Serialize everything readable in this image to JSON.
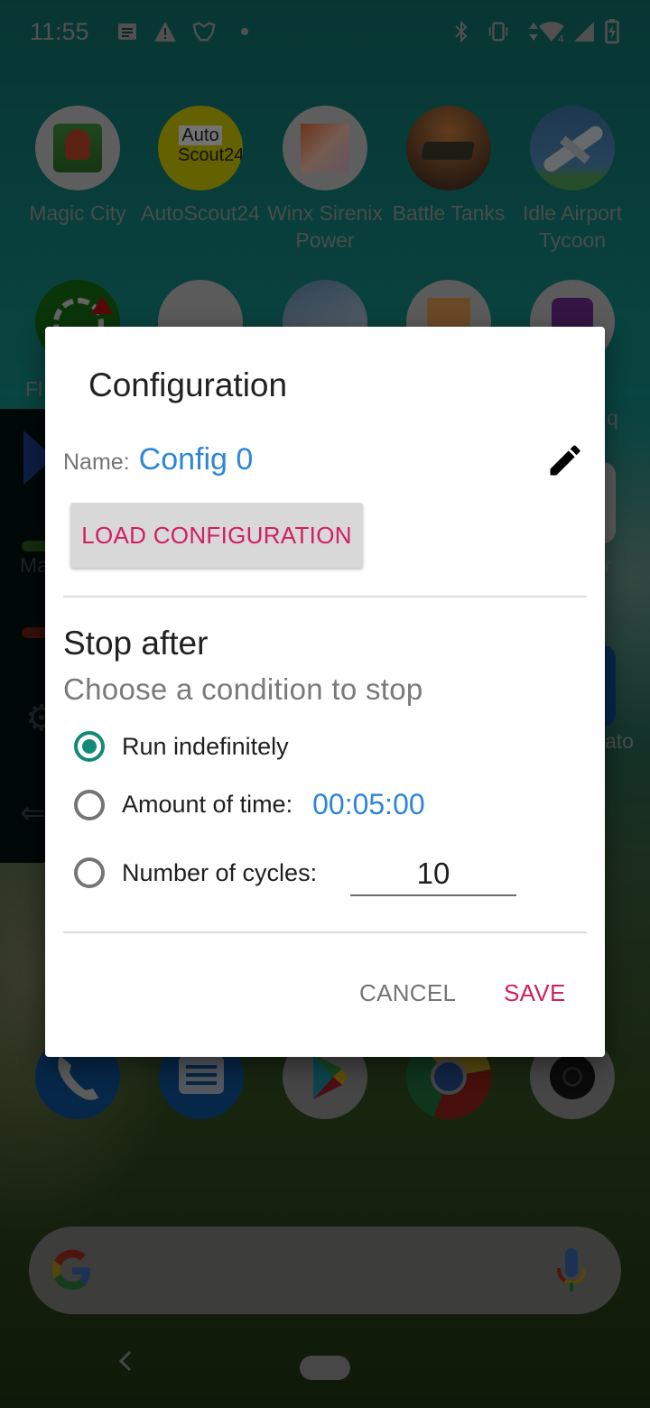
{
  "status_bar": {
    "time": "11:55",
    "left_icons": [
      "notes-icon",
      "warning-icon",
      "game-crest-icon",
      "dot-icon"
    ],
    "right_icons": [
      "bluetooth-icon",
      "vibrate-icon",
      "data-arrows-icon",
      "wifi-icon",
      "signal-icon",
      "battery-charging-icon"
    ],
    "wifi_badge": "4"
  },
  "home": {
    "apps_row1": [
      {
        "label": "Magic City",
        "icon": "magic-city-icon"
      },
      {
        "label": "AutoScout24",
        "icon": "autoscout24-icon",
        "logo_top": "Auto",
        "logo_bottom": "Scout24"
      },
      {
        "label": "Winx Sirenix Power",
        "icon": "winx-icon"
      },
      {
        "label": "Battle Tanks",
        "icon": "battle-tanks-icon"
      },
      {
        "label": "Idle Airport Tycoon",
        "icon": "idle-airport-icon"
      }
    ],
    "apps_row2_partial_labels": {
      "left": "Fl",
      "right": "q"
    },
    "partial_labels": {
      "left_ma": "Ma",
      "right_r": "r",
      "right_ato": "ato"
    },
    "dock": [
      "phone-icon",
      "messages-icon",
      "play-store-icon",
      "chrome-icon",
      "camera-icon"
    ],
    "search": {
      "placeholder": ""
    }
  },
  "dialog": {
    "title": "Configuration",
    "name_label": "Name:",
    "name_value": "Config 0",
    "load_button": "LOAD CONFIGURATION",
    "section_title": "Stop after",
    "section_subtitle": "Choose a condition to stop",
    "options": [
      {
        "label": "Run indefinitely",
        "checked": true
      },
      {
        "label": "Amount of time:",
        "checked": false,
        "value": "00:05:00"
      },
      {
        "label": "Number of cycles:",
        "checked": false,
        "value": "10"
      }
    ],
    "cancel_label": "CANCEL",
    "save_label": "SAVE"
  },
  "colors": {
    "accent": "#d21f5f",
    "link_blue": "#2f86d6",
    "radio_checked": "#138a78"
  }
}
